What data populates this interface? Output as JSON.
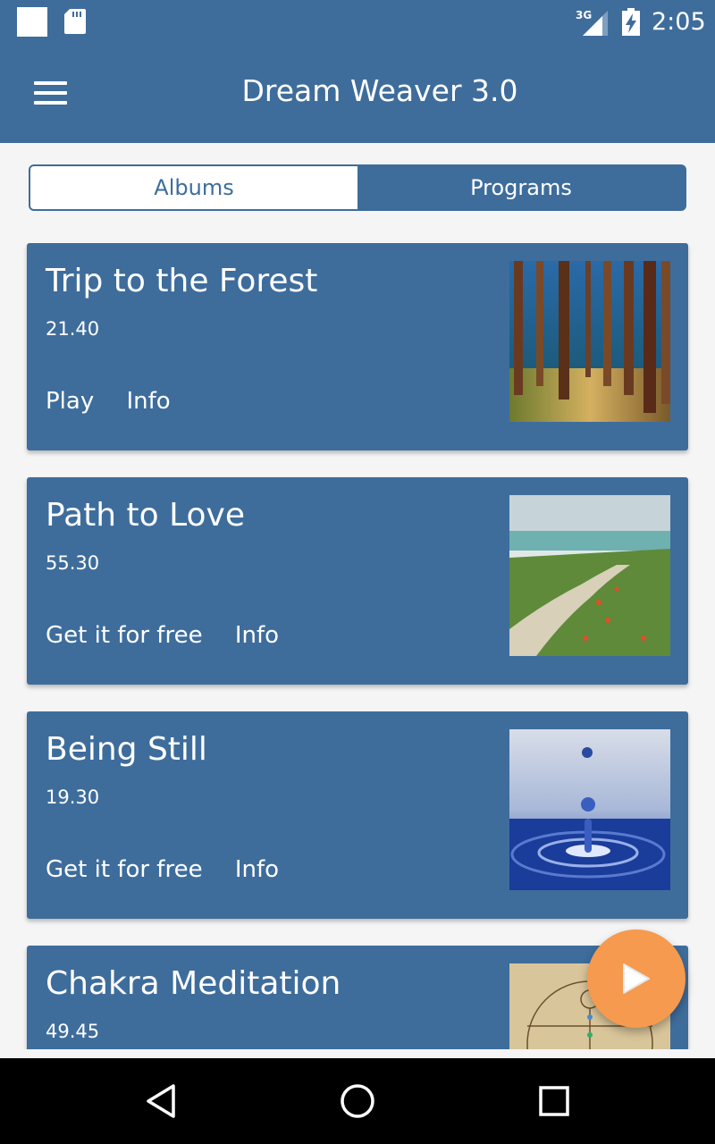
{
  "status_bar": {
    "network": "3G",
    "time": "2:05",
    "icons": [
      "notification-square-icon",
      "sd-card-icon",
      "signal-icon",
      "battery-charging-icon"
    ]
  },
  "app_bar": {
    "title": "Dream Weaver 3.0",
    "menu_icon": "hamburger-menu-icon"
  },
  "tabs": [
    {
      "label": "Albums",
      "active": true
    },
    {
      "label": "Programs",
      "active": false
    }
  ],
  "albums": [
    {
      "title": "Trip to the Forest",
      "duration": "21.40",
      "actions": [
        "Play",
        "Info"
      ],
      "thumbnail": "forest-image"
    },
    {
      "title": "Path to Love",
      "duration": "55.30",
      "actions": [
        "Get it for free",
        "Info"
      ],
      "thumbnail": "beach-path-image"
    },
    {
      "title": "Being Still",
      "duration": "19.30",
      "actions": [
        "Get it for free",
        "Info"
      ],
      "thumbnail": "water-drop-image"
    },
    {
      "title": "Chakra Meditation",
      "duration": "49.45",
      "actions": [],
      "thumbnail": "vitruvian-chakra-image"
    }
  ],
  "fab": {
    "icon": "play-icon"
  },
  "nav_bar": {
    "icons": [
      "back-icon",
      "home-icon",
      "recents-icon"
    ]
  },
  "colors": {
    "primary": "#3e6d9c",
    "accent": "#f59a4e",
    "background": "#f5f5f5"
  }
}
